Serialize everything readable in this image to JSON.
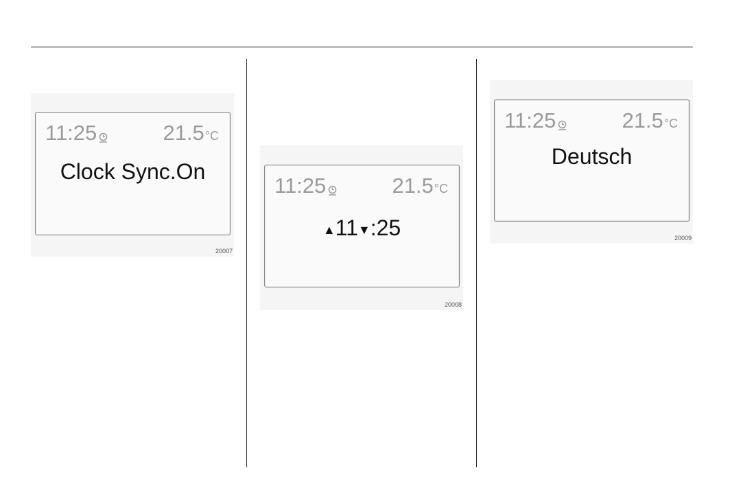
{
  "figures": [
    {
      "time": "11:25",
      "temperature": "21.5",
      "unit": "°C",
      "message": "Clock Sync.On",
      "code": "20007"
    },
    {
      "time": "11:25",
      "temperature": "21.5",
      "unit": "°C",
      "hours": "11",
      "minutes": ":25",
      "up_arrow": "▲",
      "down_arrow": "▼",
      "code": "20008"
    },
    {
      "time": "11:25",
      "temperature": "21.5",
      "unit": "°C",
      "message": "Deutsch",
      "code": "20009"
    }
  ],
  "icons": {
    "clock": "clock-icon"
  }
}
